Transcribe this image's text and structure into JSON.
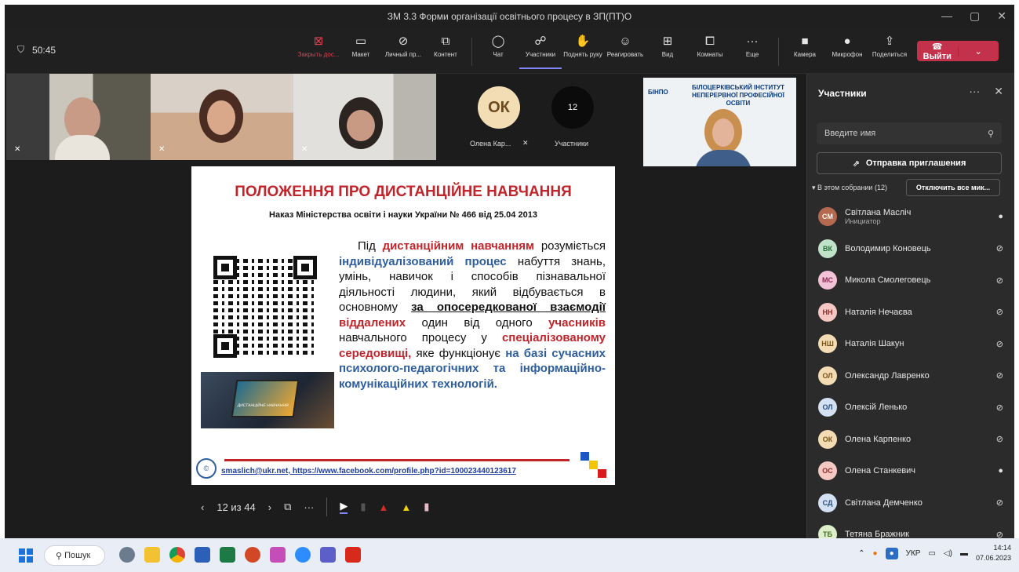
{
  "window": {
    "title": "ЗМ 3.3 Форми організації освітнього процесу в ЗП(ПТ)О",
    "timer": "50:45"
  },
  "toolbar": {
    "items": [
      {
        "label": "Закрыть дос...",
        "icon": "stop-share-icon"
      },
      {
        "label": "Макет",
        "icon": "layout-icon"
      },
      {
        "label": "Личный пр...",
        "icon": "private-view-icon"
      },
      {
        "label": "Контент",
        "icon": "content-icon"
      },
      {
        "label": "Чат",
        "icon": "chat-icon"
      },
      {
        "label": "Участники",
        "icon": "participants-icon"
      },
      {
        "label": "Поднять руку",
        "icon": "raise-hand-icon"
      },
      {
        "label": "Реагировать",
        "icon": "react-icon"
      },
      {
        "label": "Вид",
        "icon": "view-icon"
      },
      {
        "label": "Комнаты",
        "icon": "rooms-icon"
      },
      {
        "label": "Еще",
        "icon": "more-icon"
      },
      {
        "label": "Камера",
        "icon": "camera-icon"
      },
      {
        "label": "Микрофон",
        "icon": "mic-icon"
      },
      {
        "label": "Поделиться",
        "icon": "share-icon"
      }
    ],
    "leave_label": "Выйти",
    "accent": "#c4314b"
  },
  "stage": {
    "avatar_initials": "ОК",
    "avatar_name": "Олена Кар...",
    "participants_count": "12",
    "participants_label": "Участники"
  },
  "slide": {
    "title": "ПОЛОЖЕННЯ ПРО ДИСТАНЦІЙНЕ НАВЧАННЯ",
    "subtitle": "Наказ Міністерства освіти і науки України № 466 від 25.04 2013",
    "laptop_caption": "ДИСТАНЦІЙНЕ НАВЧАННЯ",
    "link": "smaslich@ukr.net, https://www.facebook.com/profile.php?id=100023440123617",
    "page": "12 из 44",
    "institute": "БІЛОЦЕРКІВСЬКИЙ ІНСТИТУТ НЕПЕРЕРВНОЇ ПРОФЕСІЙНОЇ ОСВІТИ",
    "institute_short": "БІНПО"
  },
  "panel": {
    "title": "Участники",
    "search_placeholder": "Введите имя",
    "invite": "Отправка приглашения",
    "section": "В этом собрании (12)",
    "mute_all": "Отключить все мик...",
    "participants": [
      {
        "initials": "СМ",
        "name": "Світлана Масліч",
        "role": "Инициатор",
        "mic": "on",
        "color": "#b5694f",
        "fg": "#fff"
      },
      {
        "initials": "ВК",
        "name": "Володимир Коновець",
        "role": "",
        "mic": "off",
        "color": "#bfe3c9",
        "fg": "#2b6b3b"
      },
      {
        "initials": "МС",
        "name": "Микола Смолеговець",
        "role": "",
        "mic": "off",
        "color": "#f2c3d6",
        "fg": "#8a2b54"
      },
      {
        "initials": "НН",
        "name": "Наталія Нечаєва",
        "role": "",
        "mic": "off",
        "color": "#f5c8c4",
        "fg": "#8a2f28"
      },
      {
        "initials": "НШ",
        "name": "Наталія Шакун",
        "role": "",
        "mic": "off",
        "color": "#f3dcb3",
        "fg": "#7a541b"
      },
      {
        "initials": "ОЛ",
        "name": "Олександр Лавренко",
        "role": "",
        "mic": "off",
        "color": "#f3dcb3",
        "fg": "#7a541b"
      },
      {
        "initials": "ОЛ",
        "name": "Олексій Ленько",
        "role": "",
        "mic": "off",
        "color": "#d3e1f2",
        "fg": "#2b4f80"
      },
      {
        "initials": "ОК",
        "name": "Олена Карпенко",
        "role": "",
        "mic": "off",
        "color": "#f3dcb3",
        "fg": "#7a541b"
      },
      {
        "initials": "ОС",
        "name": "Олена Станкевич",
        "role": "",
        "mic": "on",
        "color": "#f5c8c4",
        "fg": "#8a2f28"
      },
      {
        "initials": "СД",
        "name": "Світлана Демченко",
        "role": "",
        "mic": "off",
        "color": "#d3e1f2",
        "fg": "#2b4f80"
      },
      {
        "initials": "ТБ",
        "name": "Тетяна Бражник",
        "role": "",
        "mic": "off",
        "color": "#dcefc8",
        "fg": "#4a6b22"
      }
    ]
  },
  "taskbar": {
    "search": "Пошук",
    "lang": "УКР",
    "time": "14:14",
    "date": "07.06.2023"
  }
}
